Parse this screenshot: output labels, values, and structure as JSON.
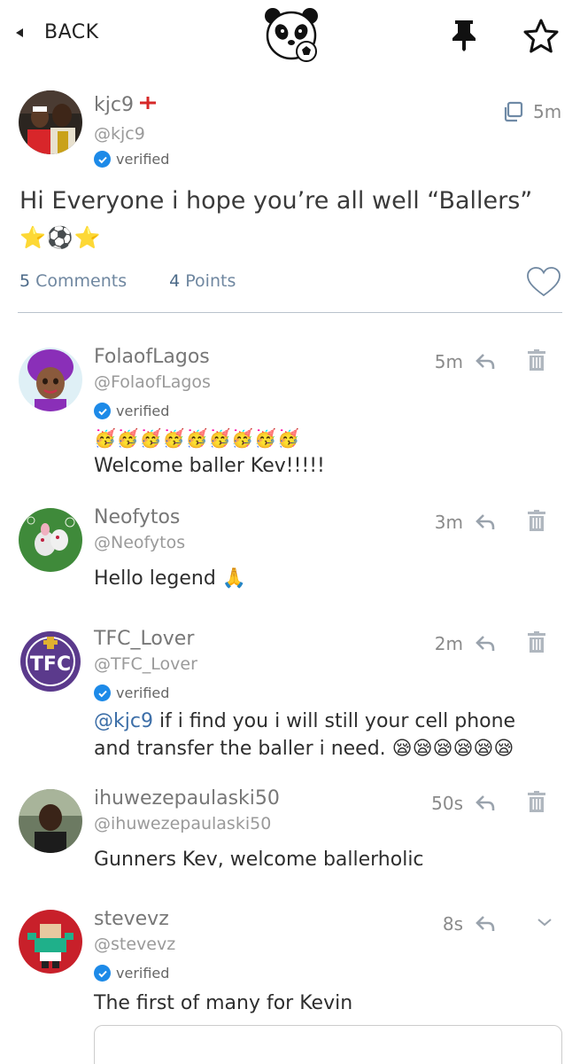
{
  "header": {
    "back_label": "BACK",
    "logo_icon": "panda-soccer-logo-icon",
    "pin_icon": "pin-icon",
    "favorite_icon": "star-icon"
  },
  "post": {
    "username": "kjc9",
    "flag": "england-flag",
    "handle": "@kjc9",
    "verified_label": "verified",
    "time": "5m",
    "text": "Hi Everyone i hope you’re all well “Ballers”",
    "emoji": "⭐⚽⭐",
    "comments_count": "5",
    "comments_label": "Comments",
    "points_count": "4",
    "points_label": "Points"
  },
  "comments": [
    {
      "username": "FolaofLagos",
      "handle": "@FolaofLagos",
      "verified_label": "verified",
      "time": "5m",
      "emoji": "🥳🥳🥳🥳🥳🥳🥳🥳🥳",
      "text": "Welcome baller Kev!!!!!"
    },
    {
      "username": "Neofytos",
      "handle": "@Neofytos",
      "time": "3m",
      "text": "Hello legend 🙏"
    },
    {
      "username": "TFC_Lover",
      "handle": "@TFC_Lover",
      "verified_label": "verified",
      "time": "2m",
      "mention": "@kjc9",
      "text": " if i find you i will still your cell phone and transfer the baller i need. 😪😪😪😪😪😪"
    },
    {
      "username": "ihuwezepaulaski50",
      "handle": "@ihuwezepaulaski50",
      "time": "50s",
      "text": "Gunners Kev, welcome ballerholic"
    },
    {
      "username": "stevevz",
      "handle": "@stevevz",
      "verified_label": "verified",
      "time": "8s",
      "text": "The first of many for Kevin"
    }
  ],
  "colors": {
    "verified_blue": "#1d8ae8",
    "stats_blue": "#6f87a0",
    "divider": "#b9c2cc",
    "icon_gray": "#b0b7bf"
  }
}
